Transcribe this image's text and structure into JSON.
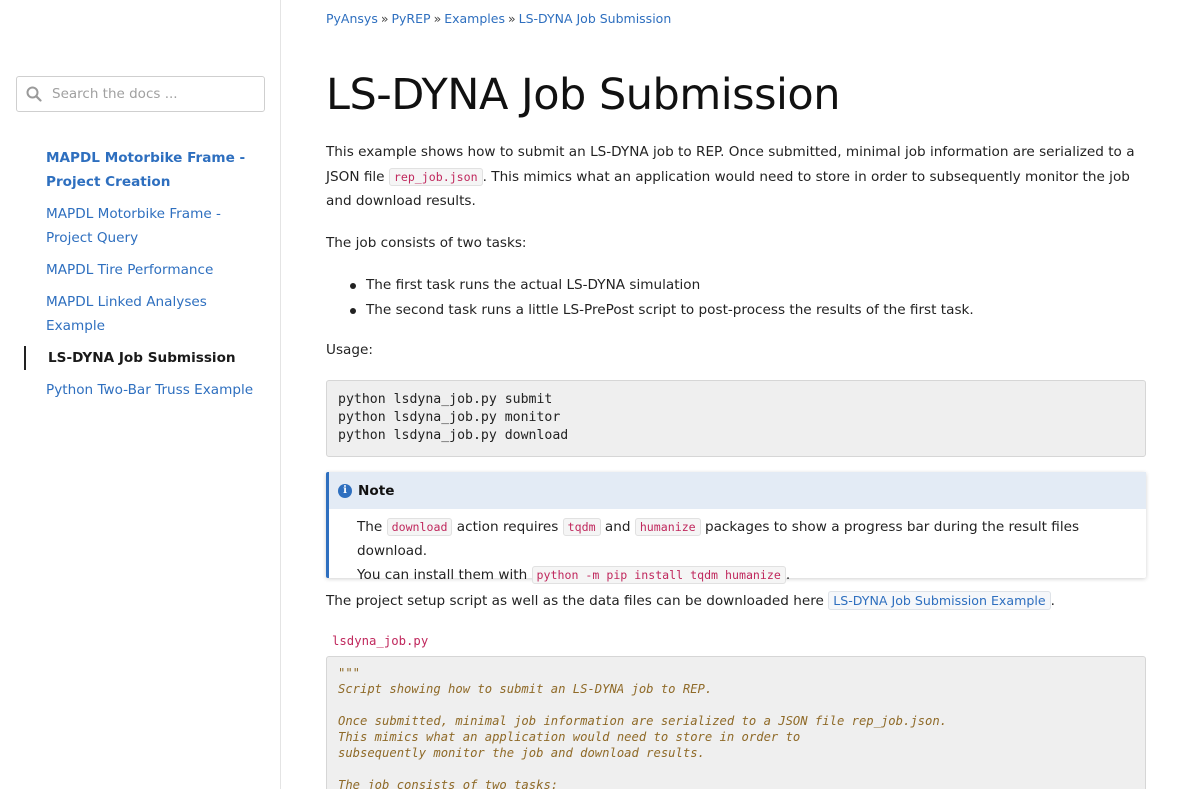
{
  "sidebar": {
    "search_placeholder": "Search the docs ...",
    "items": [
      {
        "label": "MAPDL Motorbike Frame - Project Creation"
      },
      {
        "label": "MAPDL Motorbike Frame - Project Query"
      },
      {
        "label": "MAPDL Tire Performance"
      },
      {
        "label": "MAPDL Linked Analyses Example"
      },
      {
        "label": "LS-DYNA Job Submission"
      },
      {
        "label": "Python Two-Bar Truss Example"
      }
    ]
  },
  "breadcrumb": [
    "PyAnsys",
    "PyREP",
    "Examples",
    "LS-DYNA Job Submission"
  ],
  "page": {
    "title": "LS-DYNA Job Submission",
    "intro_1": "This example shows how to submit an LS-DYNA job to REP. Once submitted, minimal job information are serialized to a JSON file",
    "intro_code": "rep_job.json",
    "intro_2": ". This mimics what an application would need to store in order to subsequently monitor the job and download results.",
    "tasks_intro": "The job consists of two tasks:",
    "tasks": [
      "The first task runs the actual LS-DYNA simulation",
      "The second task runs a little LS-PrePost script to post-process the results of the first task."
    ],
    "usage_label": "Usage:",
    "usage_lines": [
      "python lsdyna_job.py submit",
      "python lsdyna_job.py monitor",
      "python lsdyna_job.py download"
    ],
    "note": {
      "title": "Note",
      "t1": "The ",
      "c1": "download",
      "t2": " action requires ",
      "c2": "tqdm",
      "t3": " and ",
      "c3": "humanize",
      "t4": " packages to show a progress bar during the result files download.",
      "t5": "You can install them with ",
      "c4": "python -m pip install tqdm humanize",
      "t6": "."
    },
    "download_text": "The project setup script as well as the data files can be downloaded here ",
    "download_link": "LS-DYNA Job Submission Example",
    "download_end": ".",
    "file_name": "lsdyna_job.py",
    "source_lines": [
      "\"\"\"",
      "Script showing how to submit an LS-DYNA job to REP.",
      "",
      "Once submitted, minimal job information are serialized to a JSON file rep_job.json.",
      "This mimics what an application would need to store in order to",
      "subsequently monitor the job and download results.",
      "",
      "The job consists of two tasks:"
    ]
  }
}
